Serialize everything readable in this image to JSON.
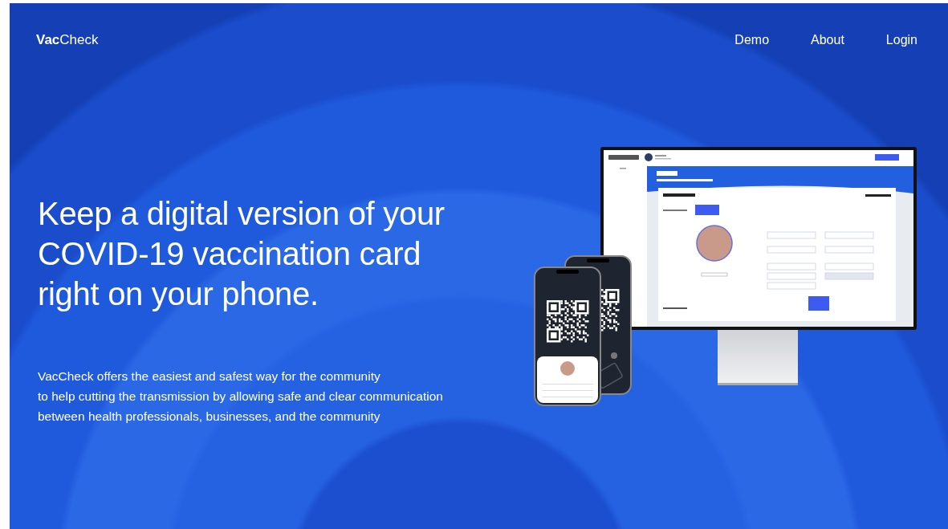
{
  "nav": {
    "logo": "**Vac**Check",
    "links": [
      {
        "label": "Demo"
      },
      {
        "label": "About"
      },
      {
        "label": "Login"
      }
    ]
  },
  "hero": {
    "headline": "Keep a digital version of your\nCOVID-19 vaccination card\nright on your phone.",
    "description": "VacCheck offers the easiest and safest way for the community\nto help cutting the transmission by allowing safe and clear communication\nbetween health professionals, businesses, and the community"
  }
}
